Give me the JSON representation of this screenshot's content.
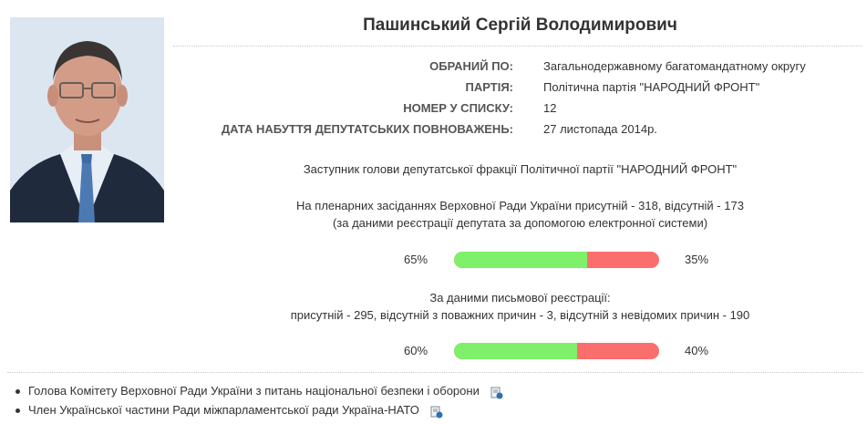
{
  "deputy": {
    "name": "Пашинський Сергій Володимирович",
    "photo_alt": "Фото депутата"
  },
  "info": [
    {
      "label": "ОБРАНИЙ ПО:",
      "value": "Загальнодержавному багатомандатному округу"
    },
    {
      "label": "ПАРТІЯ:",
      "value": "Політична партія \"НАРОДНИЙ ФРОНТ\""
    },
    {
      "label": "НОМЕР У СПИСКУ:",
      "value": "12"
    },
    {
      "label": "ДАТА НАБУТТЯ ДЕПУТАТСЬКИХ ПОВНОВАЖЕНЬ:",
      "value": "27 листопада 2014р."
    }
  ],
  "faction_role": "Заступник голови депутатської фракції Політичної партії \"НАРОДНИЙ ФРОНТ\"",
  "plenary": {
    "line1": "На пленарних засіданнях Верховної Ради України присутній - 318, відсутній - 173",
    "line2": "(за даними реєстрації депутата за допомогою електронної системи)",
    "present_pct_label": "65%",
    "absent_pct_label": "35%",
    "present_fraction": 0.65
  },
  "written": {
    "line1": "За даними письмової реєстрації:",
    "line2": "присутній - 295, відсутній з поважних причин - 3, відсутній з невідомих причин - 190",
    "present_pct_label": "60%",
    "absent_pct_label": "40%",
    "present_fraction": 0.6
  },
  "colors": {
    "present": "#7ef06a",
    "absent": "#fb6e6e"
  },
  "posts": [
    {
      "label": "Голова Комітету Верховної Ради України з питань національної безпеки і оборони",
      "icon": "document-icon"
    },
    {
      "label": "Член Української частини Ради міжпарламентської ради Україна-НАТО",
      "icon": "document-icon"
    }
  ]
}
